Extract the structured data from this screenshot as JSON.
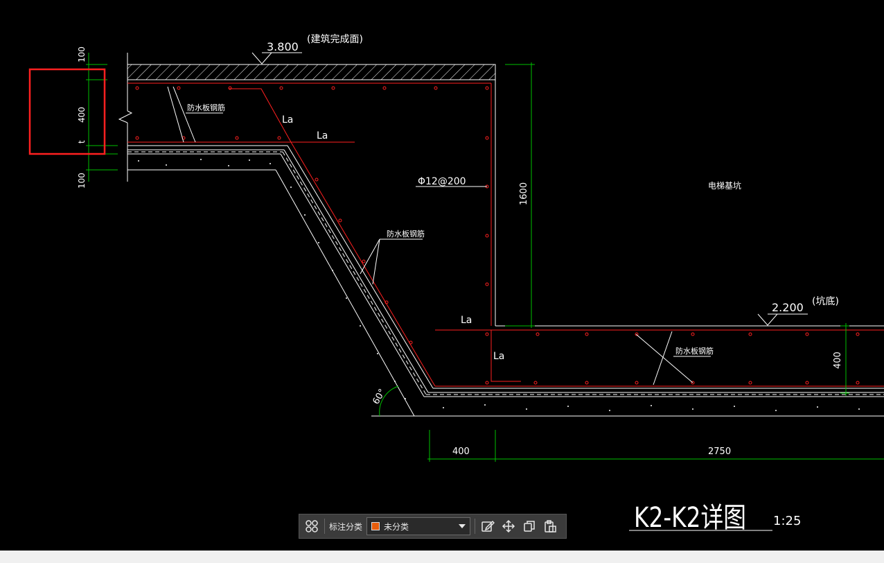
{
  "drawing": {
    "elevation_top": "3.800",
    "elevation_top_note": "(建筑完成面)",
    "elevation_bottom": "2.200",
    "elevation_bottom_note": "(坑底)",
    "label_la": "La",
    "rebar_spec": "Φ12@200",
    "waterproof_rebar": "防水板钢筋",
    "pit_label": "电梯基坑",
    "dim_1600": "1600",
    "dim_400_right": "400",
    "dim_400_bottom": "400",
    "dim_2750": "2750",
    "dim_100_top": "100",
    "dim_400_left": "400",
    "dim_t": "t",
    "dim_100_bottom": "100",
    "angle": "60°",
    "title": "K2-K2详图",
    "scale": "1:25"
  },
  "toolbar": {
    "category_label": "标注分类",
    "category_value": "未分类",
    "category_color": "#e85d0c",
    "icons": [
      "grid-icon",
      "edit-icon",
      "move-icon",
      "copy-icon",
      "paste-icon"
    ]
  },
  "colors": {
    "rebar": "#ff2020",
    "dimension": "#00c000",
    "outline": "#ffffff",
    "highlight_box": "#ff2020"
  }
}
